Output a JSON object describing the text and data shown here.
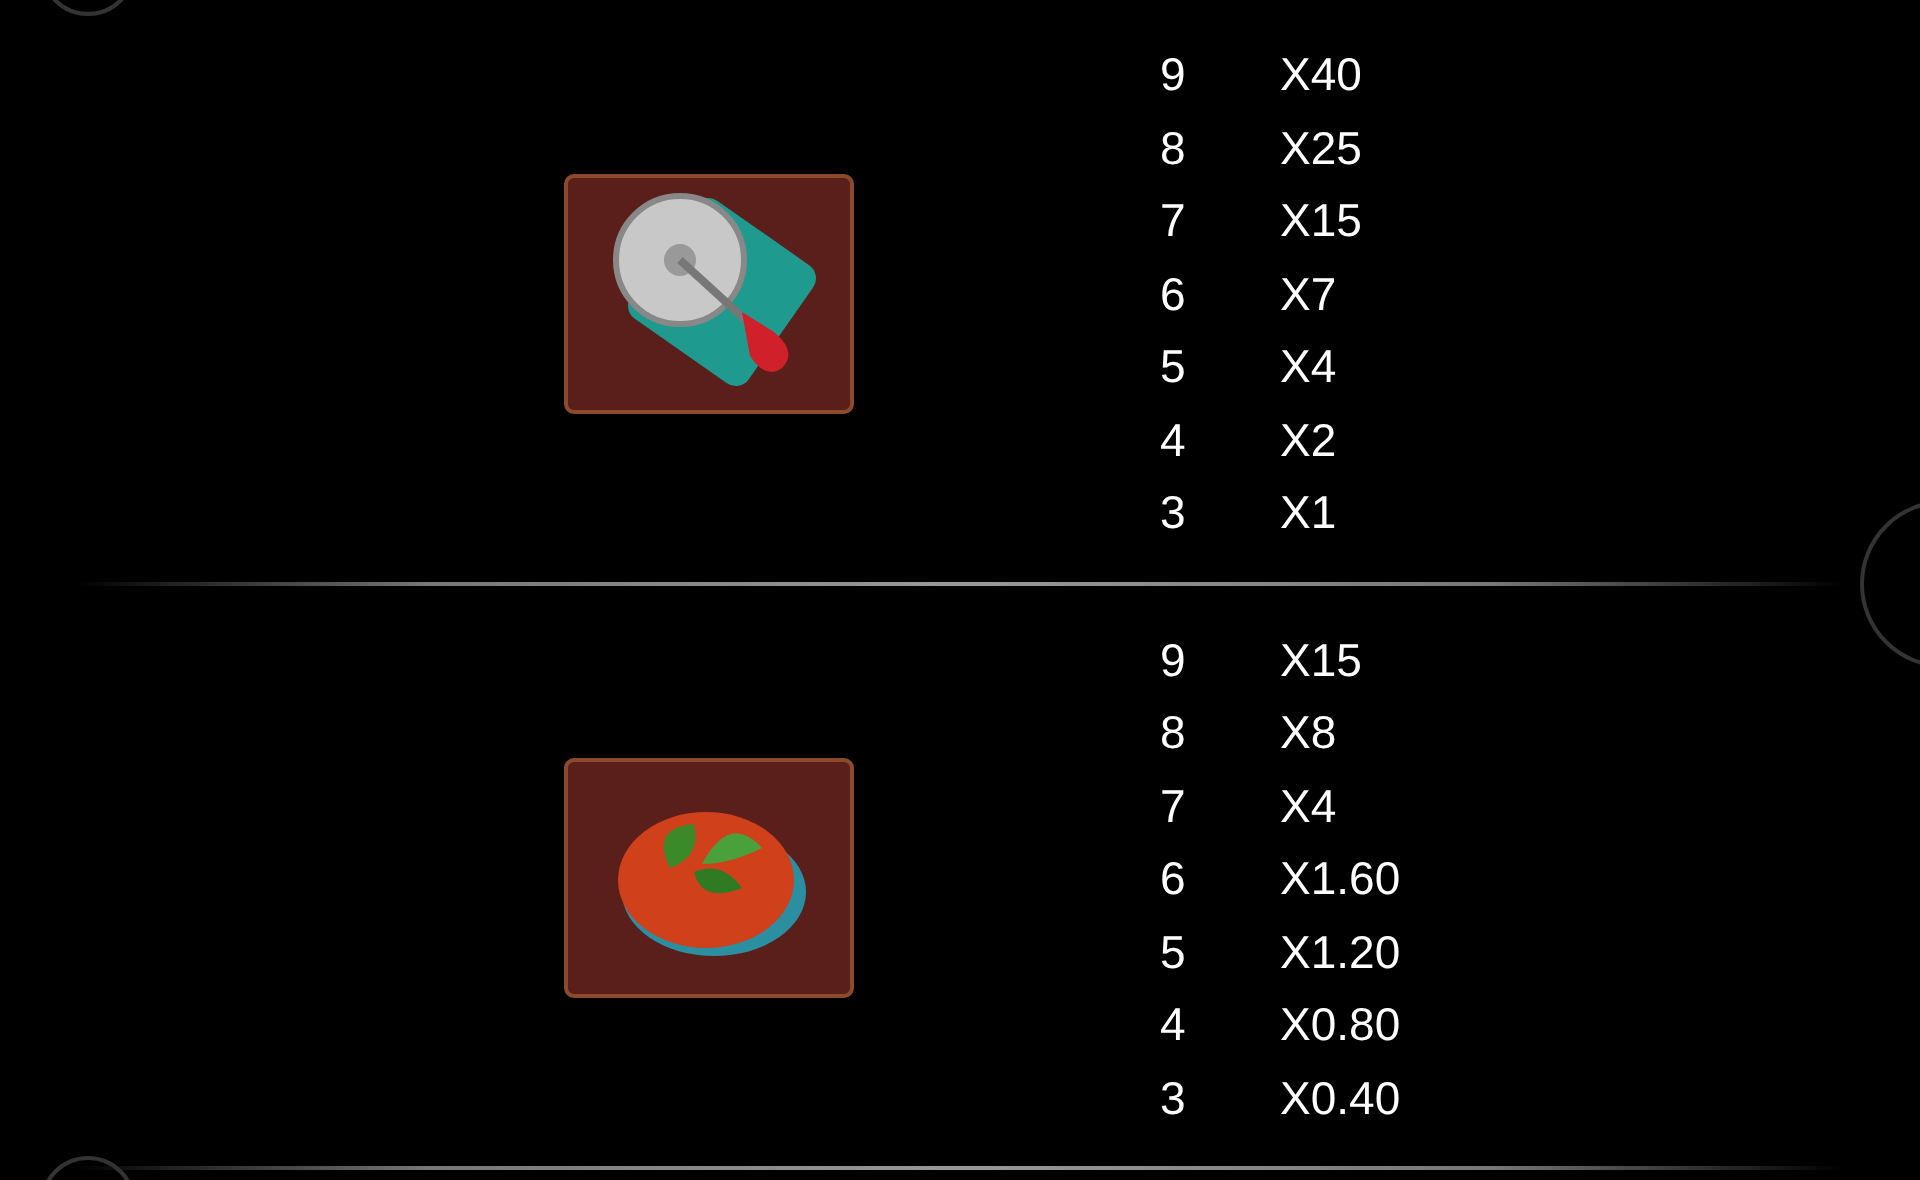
{
  "paytables": [
    {
      "kind": "cutter",
      "payouts": [
        {
          "count": "9",
          "multiplier": "X40"
        },
        {
          "count": "8",
          "multiplier": "X25"
        },
        {
          "count": "7",
          "multiplier": "X15"
        },
        {
          "count": "6",
          "multiplier": "X7"
        },
        {
          "count": "5",
          "multiplier": "X4"
        },
        {
          "count": "4",
          "multiplier": "X2"
        },
        {
          "count": "3",
          "multiplier": "X1"
        }
      ]
    },
    {
      "kind": "tomato",
      "payouts": [
        {
          "count": "9",
          "multiplier": "X15"
        },
        {
          "count": "8",
          "multiplier": "X8"
        },
        {
          "count": "7",
          "multiplier": "X4"
        },
        {
          "count": "6",
          "multiplier": "X1.60"
        },
        {
          "count": "5",
          "multiplier": "X1.20"
        },
        {
          "count": "4",
          "multiplier": "X0.80"
        },
        {
          "count": "3",
          "multiplier": "X0.40"
        }
      ]
    }
  ]
}
